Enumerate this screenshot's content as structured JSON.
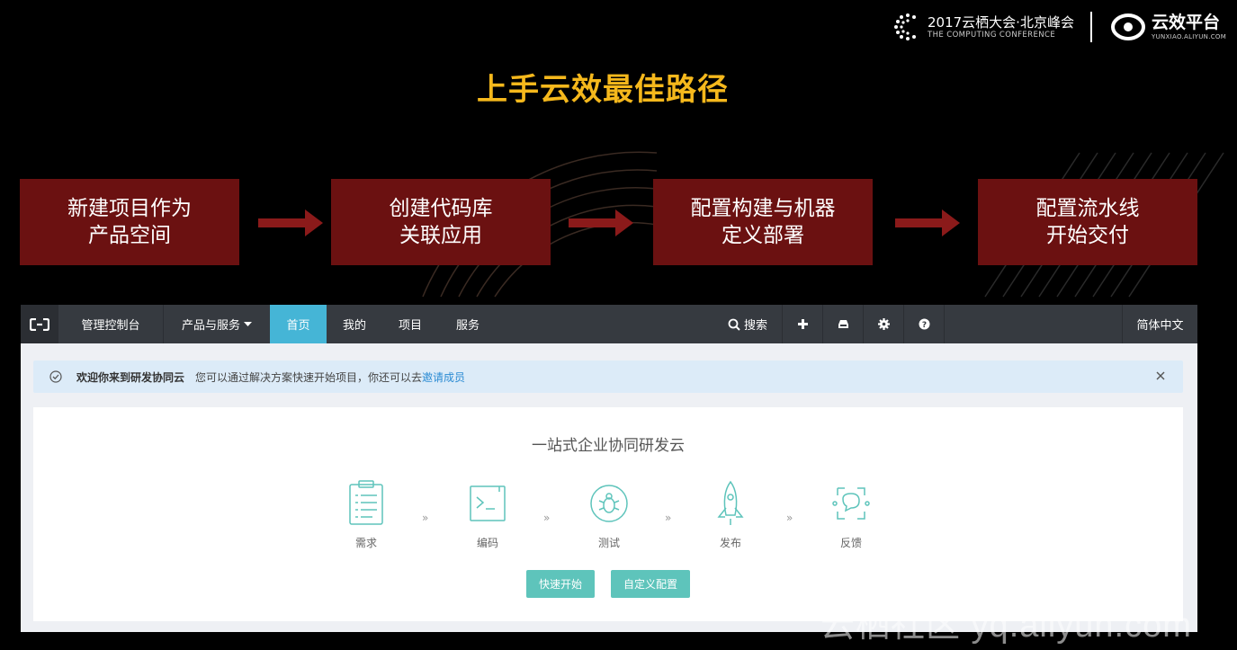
{
  "header": {
    "conference_line1": "2017云栖大会·北京峰会",
    "conference_line2": "THE COMPUTING CONFERENCE",
    "brand_name": "云效平台",
    "brand_url": "YUNXIAO.ALIYUN.COM"
  },
  "title": "上手云效最佳路径",
  "steps": [
    {
      "label": "新建项目作为\n产品空间"
    },
    {
      "label": "创建代码库\n关联应用"
    },
    {
      "label": "配置构建与机器\n定义部署"
    },
    {
      "label": "配置流水线\n开始交付"
    }
  ],
  "colors": {
    "title": "#f5b81c",
    "step_box": "#6b1111",
    "arrow": "#8b1a1a",
    "nav_bg": "#363a40",
    "nav_active": "#45b5d6",
    "accent_teal": "#5ec4bb",
    "link": "#2b8bd3"
  },
  "nav": {
    "console": "管理控制台",
    "products": "产品与服务",
    "home": "首页",
    "mine": "我的",
    "projects": "项目",
    "services": "服务",
    "search": "搜索",
    "language": "简体中文",
    "icons": [
      "aliyun-logo-icon",
      "chevron-down-icon",
      "search-icon",
      "plus-icon",
      "inbox-icon",
      "gear-icon",
      "help-icon"
    ]
  },
  "welcome": {
    "title": "欢迎你来到研发协同云",
    "message": "您可以通过解决方案快速开始项目，你还可以去",
    "link": "邀请成员"
  },
  "panel": {
    "title": "一站式企业协同研发云",
    "flow": [
      {
        "label": "需求",
        "icon": "clipboard-icon"
      },
      {
        "label": "编码",
        "icon": "terminal-icon"
      },
      {
        "label": "测试",
        "icon": "bug-icon"
      },
      {
        "label": "发布",
        "icon": "rocket-icon"
      },
      {
        "label": "反馈",
        "icon": "chat-feedback-icon"
      }
    ],
    "chevron": "»",
    "buttons": {
      "quick_start": "快速开始",
      "custom_config": "自定义配置"
    }
  },
  "watermark": "云栖社区 yq.aliyun.com"
}
